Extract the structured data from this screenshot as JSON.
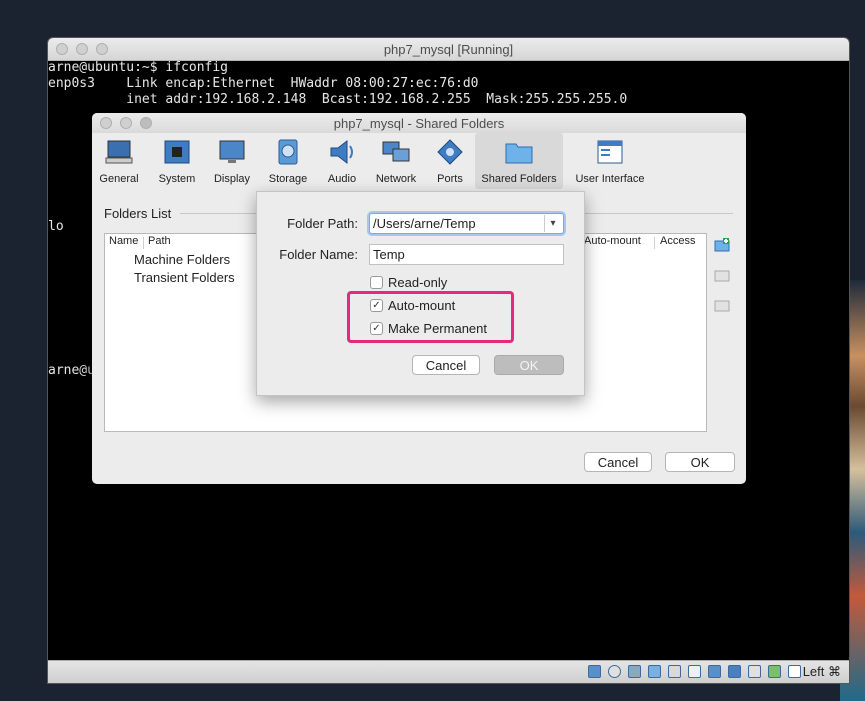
{
  "vm_window": {
    "title": "php7_mysql [Running]",
    "terminal_lines": [
      "arne@ubuntu:~$ ifconfig",
      "enp0s3    Link encap:Ethernet  HWaddr 08:00:27:ec:76:d0",
      "          inet addr:192.168.2.148  Bcast:192.168.2.255  Mask:255.255.255.0",
      "lo",
      "arne@u"
    ],
    "host_key": "Left ⌘"
  },
  "settings_dialog": {
    "title": "php7_mysql - Shared Folders",
    "toolbar": [
      {
        "label": "General",
        "icon": "general-icon"
      },
      {
        "label": "System",
        "icon": "system-chip-icon"
      },
      {
        "label": "Display",
        "icon": "display-monitor-icon"
      },
      {
        "label": "Storage",
        "icon": "storage-disk-icon"
      },
      {
        "label": "Audio",
        "icon": "audio-speaker-icon"
      },
      {
        "label": "Network",
        "icon": "network-icon"
      },
      {
        "label": "Ports",
        "icon": "ports-icon"
      },
      {
        "label": "Shared Folders",
        "icon": "folder-icon",
        "active": true
      },
      {
        "label": "User Interface",
        "icon": "user-interface-icon"
      }
    ],
    "folders_list_title": "Folders List",
    "columns": [
      "Name",
      "Path",
      "Auto-mount",
      "Access"
    ],
    "tree_items": [
      "Machine Folders",
      "Transient Folders"
    ],
    "cancel_label": "Cancel",
    "ok_label": "OK"
  },
  "shared_folder_dialog": {
    "folder_path_label": "Folder Path:",
    "folder_path_value": "/Users/arne/Temp",
    "folder_name_label": "Folder Name:",
    "folder_name_value": "Temp",
    "read_only_label": "Read-only",
    "read_only_checked": false,
    "auto_mount_label": "Auto-mount",
    "auto_mount_checked": true,
    "make_permanent_label": "Make Permanent",
    "make_permanent_checked": true,
    "cancel_label": "Cancel",
    "ok_label": "OK"
  },
  "colors": {
    "highlight": "#e8287a",
    "accent_focus": "#7fa8dd"
  }
}
